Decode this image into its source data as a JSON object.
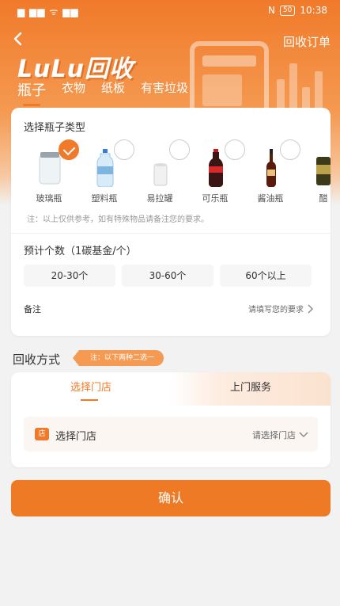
{
  "status_bar": {
    "left": "▆ ▆▆ ᯤ ▆▆",
    "nfc": "N",
    "battery": "50",
    "time": "10:38"
  },
  "header": {
    "logo": "LuLu回收",
    "order_link": "回收订单",
    "tabs": [
      {
        "label": "瓶子",
        "active": true
      },
      {
        "label": "衣物",
        "active": false
      },
      {
        "label": "纸板",
        "active": false
      },
      {
        "label": "有害垃圾",
        "active": false
      }
    ]
  },
  "bottle_section": {
    "title": "选择瓶子类型",
    "items": [
      {
        "label": "玻璃瓶",
        "checked": true,
        "icon": "glass-jar"
      },
      {
        "label": "塑料瓶",
        "checked": false,
        "icon": "plastic-bottle"
      },
      {
        "label": "易拉罐",
        "checked": false,
        "icon": "can"
      },
      {
        "label": "可乐瓶",
        "checked": false,
        "icon": "cola-bottle"
      },
      {
        "label": "酱油瓶",
        "checked": false,
        "icon": "soy-sauce-bottle"
      },
      {
        "label": "醋",
        "checked": false,
        "icon": "vinegar-bottle"
      }
    ],
    "note": "注：以上仅供参考，如有特殊物品请备注您的要求。"
  },
  "quantity_section": {
    "title": "预计个数（1碳基金/个）",
    "options": [
      "20-30个",
      "30-60个",
      "60个以上"
    ]
  },
  "remark": {
    "label": "备注",
    "placeholder": "请填写您的要求"
  },
  "method": {
    "title": "回收方式",
    "note": "注：以下两种二选一",
    "tab_store": "选择门店",
    "tab_home": "上门服务",
    "store_icon": "店",
    "store_label": "选择门店",
    "store_value": "请选择门店"
  },
  "confirm": "确认",
  "colors": {
    "accent": "#ee7a25",
    "header_top": "#f07a2a"
  }
}
